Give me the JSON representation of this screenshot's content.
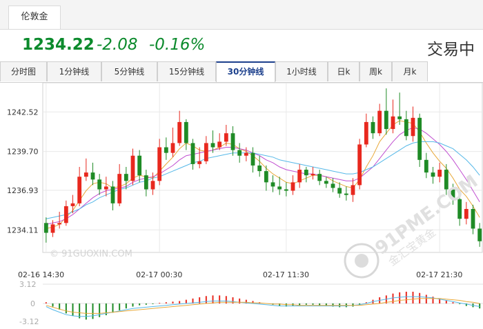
{
  "top_tab": {
    "label": "伦敦金"
  },
  "quote": {
    "price": "1234.22",
    "change": "-2.08",
    "change_pct": "-0.16%",
    "status": "交易中"
  },
  "period_tabs": [
    {
      "label": "分时图"
    },
    {
      "label": "1分钟线"
    },
    {
      "label": "5分钟线"
    },
    {
      "label": "15分钟线"
    },
    {
      "label": "30分钟线",
      "active": true
    },
    {
      "label": "1小时线"
    },
    {
      "label": "日k"
    },
    {
      "label": "周k"
    },
    {
      "label": "月k"
    }
  ],
  "watermarks": {
    "left": "© 91GUOXIN.COM",
    "right_brand": "91PME.COM",
    "right_sub": "金汇宝黄金"
  },
  "colors": {
    "up": "#e8281e",
    "down": "#1f8b26",
    "ma1": "#e8a838",
    "ma2": "#c04ed0",
    "ma3": "#55b8e8",
    "accent": "#1b3f8c"
  },
  "chart_data": {
    "type": "candlestick",
    "ylim": [
      1232.5,
      1244.6
    ],
    "y_ticks": [
      "1242.52",
      "1239.70",
      "1236.93",
      "1234.11"
    ],
    "x_tick_labels": [
      "02-16 14:30",
      "02-17 00:30",
      "02-17 11:30",
      "02-17 21:30"
    ],
    "x_tick_index": [
      0,
      17,
      36,
      59
    ],
    "macd_ticks": [
      "3.12",
      "0",
      "-3.12"
    ],
    "candles": [
      [
        1234.6,
        1233.9,
        1235.0,
        1233.2
      ],
      [
        1233.9,
        1234.5,
        1234.8,
        1233.6
      ],
      [
        1234.5,
        1234.6,
        1235.4,
        1234.2
      ],
      [
        1234.6,
        1235.8,
        1236.2,
        1234.4
      ],
      [
        1235.8,
        1236.0,
        1236.6,
        1235.3
      ],
      [
        1236.0,
        1237.9,
        1238.6,
        1235.8
      ],
      [
        1237.9,
        1238.2,
        1239.2,
        1237.6
      ],
      [
        1238.2,
        1237.7,
        1238.9,
        1237.3
      ],
      [
        1237.7,
        1237.0,
        1238.1,
        1236.6
      ],
      [
        1237.0,
        1237.2,
        1237.9,
        1236.5
      ],
      [
        1237.2,
        1236.0,
        1237.6,
        1235.5
      ],
      [
        1236.0,
        1238.1,
        1238.8,
        1235.8
      ],
      [
        1238.1,
        1237.6,
        1238.6,
        1237.0
      ],
      [
        1237.6,
        1239.4,
        1239.9,
        1237.3
      ],
      [
        1239.4,
        1238.0,
        1239.8,
        1237.5
      ],
      [
        1238.0,
        1237.0,
        1238.4,
        1236.5
      ],
      [
        1237.0,
        1237.6,
        1238.2,
        1236.6
      ],
      [
        1237.6,
        1240.0,
        1240.6,
        1237.3
      ],
      [
        1240.0,
        1239.6,
        1240.7,
        1239.1
      ],
      [
        1239.6,
        1240.3,
        1241.4,
        1239.3
      ],
      [
        1240.3,
        1241.8,
        1242.6,
        1240.1
      ],
      [
        1241.8,
        1240.3,
        1242.0,
        1239.8
      ],
      [
        1240.3,
        1238.8,
        1240.6,
        1238.4
      ],
      [
        1238.8,
        1239.0,
        1240.0,
        1238.5
      ],
      [
        1239.0,
        1240.3,
        1240.8,
        1238.8
      ],
      [
        1240.3,
        1240.0,
        1241.2,
        1239.6
      ],
      [
        1240.0,
        1240.4,
        1241.0,
        1239.8
      ],
      [
        1240.4,
        1241.0,
        1241.6,
        1240.1
      ],
      [
        1241.0,
        1239.8,
        1241.5,
        1239.4
      ],
      [
        1239.8,
        1239.4,
        1240.3,
        1238.9
      ],
      [
        1239.4,
        1239.6,
        1240.0,
        1239.0
      ],
      [
        1239.6,
        1238.7,
        1240.0,
        1238.2
      ],
      [
        1238.7,
        1238.3,
        1239.4,
        1237.9
      ],
      [
        1238.3,
        1237.5,
        1238.7,
        1236.9
      ],
      [
        1237.5,
        1237.2,
        1238.0,
        1236.8
      ],
      [
        1237.2,
        1237.0,
        1237.9,
        1236.6
      ],
      [
        1237.0,
        1236.9,
        1237.5,
        1236.5
      ],
      [
        1236.9,
        1237.5,
        1238.0,
        1236.6
      ],
      [
        1237.5,
        1238.4,
        1238.8,
        1237.1
      ],
      [
        1238.4,
        1238.0,
        1238.6,
        1237.5
      ],
      [
        1238.0,
        1238.1,
        1238.6,
        1237.7
      ],
      [
        1238.1,
        1237.6,
        1238.4,
        1237.3
      ],
      [
        1237.6,
        1237.4,
        1237.9,
        1237.1
      ],
      [
        1237.4,
        1237.1,
        1237.8,
        1236.8
      ],
      [
        1237.1,
        1236.7,
        1237.5,
        1236.4
      ],
      [
        1236.7,
        1236.6,
        1237.2,
        1236.2
      ],
      [
        1236.6,
        1237.3,
        1237.8,
        1236.1
      ],
      [
        1237.3,
        1240.2,
        1240.6,
        1237.0
      ],
      [
        1240.2,
        1241.8,
        1242.4,
        1240.0
      ],
      [
        1241.8,
        1241.0,
        1242.2,
        1240.6
      ],
      [
        1241.0,
        1242.6,
        1243.1,
        1240.8
      ],
      [
        1242.6,
        1241.3,
        1244.2,
        1240.9
      ],
      [
        1241.3,
        1242.2,
        1243.4,
        1241.0
      ],
      [
        1242.2,
        1242.0,
        1243.9,
        1241.6
      ],
      [
        1242.0,
        1240.8,
        1242.6,
        1240.5
      ],
      [
        1240.8,
        1242.1,
        1242.9,
        1240.4
      ],
      [
        1242.1,
        1239.1,
        1242.4,
        1238.6
      ],
      [
        1239.1,
        1238.2,
        1239.6,
        1237.8
      ],
      [
        1238.2,
        1237.9,
        1238.6,
        1237.4
      ],
      [
        1237.9,
        1238.4,
        1238.9,
        1237.5
      ],
      [
        1238.4,
        1237.0,
        1238.8,
        1236.6
      ],
      [
        1237.0,
        1236.3,
        1237.4,
        1235.9
      ],
      [
        1236.3,
        1234.9,
        1236.7,
        1234.4
      ],
      [
        1234.9,
        1235.6,
        1236.1,
        1234.5
      ],
      [
        1235.6,
        1234.2,
        1235.9,
        1233.8
      ],
      [
        1234.2,
        1233.3,
        1234.6,
        1232.9
      ]
    ],
    "ma_fast": [
      1234.2,
      1234.3,
      1234.5,
      1235.0,
      1235.5,
      1236.2,
      1236.9,
      1237.4,
      1237.5,
      1237.4,
      1237.1,
      1237.2,
      1237.4,
      1237.8,
      1238.0,
      1237.9,
      1237.8,
      1238.3,
      1238.8,
      1239.3,
      1239.9,
      1240.3,
      1240.1,
      1239.8,
      1239.7,
      1239.8,
      1240.0,
      1240.3,
      1240.2,
      1239.9,
      1239.7,
      1239.4,
      1239.0,
      1238.5,
      1238.1,
      1237.8,
      1237.5,
      1237.4,
      1237.6,
      1237.8,
      1238.0,
      1238.0,
      1237.9,
      1237.6,
      1237.4,
      1237.2,
      1237.1,
      1237.7,
      1238.6,
      1239.4,
      1240.4,
      1241.0,
      1241.6,
      1241.9,
      1241.8,
      1241.7,
      1241.1,
      1240.3,
      1239.6,
      1239.0,
      1238.5,
      1237.8,
      1237.0,
      1236.5,
      1235.8,
      1235.0
    ],
    "ma_mid": [
      1234.5,
      1234.6,
      1234.7,
      1234.9,
      1235.2,
      1235.6,
      1236.0,
      1236.4,
      1236.7,
      1236.9,
      1237.0,
      1237.1,
      1237.2,
      1237.5,
      1237.7,
      1237.8,
      1237.9,
      1238.1,
      1238.4,
      1238.7,
      1239.1,
      1239.4,
      1239.5,
      1239.6,
      1239.7,
      1239.8,
      1239.9,
      1240.0,
      1240.0,
      1239.9,
      1239.8,
      1239.6,
      1239.4,
      1239.1,
      1238.9,
      1238.6,
      1238.4,
      1238.3,
      1238.2,
      1238.1,
      1238.1,
      1238.0,
      1237.9,
      1237.8,
      1237.7,
      1237.6,
      1237.6,
      1237.8,
      1238.2,
      1238.6,
      1239.2,
      1239.8,
      1240.4,
      1240.9,
      1241.2,
      1241.4,
      1241.3,
      1241.0,
      1240.6,
      1240.2,
      1239.7,
      1239.1,
      1238.4,
      1237.7,
      1236.9,
      1236.1
    ],
    "ma_slow": [
      1234.9,
      1235.0,
      1235.1,
      1235.2,
      1235.4,
      1235.6,
      1235.9,
      1236.1,
      1236.4,
      1236.6,
      1236.8,
      1237.0,
      1237.1,
      1237.3,
      1237.5,
      1237.6,
      1237.8,
      1237.9,
      1238.1,
      1238.3,
      1238.5,
      1238.7,
      1238.9,
      1239.0,
      1239.2,
      1239.3,
      1239.4,
      1239.5,
      1239.6,
      1239.6,
      1239.6,
      1239.6,
      1239.5,
      1239.4,
      1239.3,
      1239.1,
      1239.0,
      1238.9,
      1238.8,
      1238.7,
      1238.6,
      1238.5,
      1238.4,
      1238.3,
      1238.2,
      1238.1,
      1238.1,
      1238.2,
      1238.4,
      1238.6,
      1238.9,
      1239.2,
      1239.5,
      1239.8,
      1240.1,
      1240.3,
      1240.4,
      1240.4,
      1240.4,
      1240.3,
      1240.1,
      1239.9,
      1239.5,
      1239.1,
      1238.6,
      1238.0
    ],
    "macd_hist": [
      0.2,
      -0.5,
      -1.0,
      -1.6,
      -2.0,
      -2.4,
      -2.6,
      -2.5,
      -2.2,
      -1.9,
      -1.5,
      -1.1,
      -0.8,
      -0.5,
      -0.3,
      -0.2,
      -0.1,
      0.1,
      0.2,
      0.3,
      0.4,
      0.6,
      0.8,
      1.0,
      1.2,
      1.3,
      1.3,
      1.2,
      1.0,
      0.8,
      0.6,
      0.4,
      0.2,
      0.0,
      -0.2,
      -0.4,
      -0.5,
      -0.4,
      -0.3,
      -0.2,
      -0.2,
      -0.3,
      -0.4,
      -0.5,
      -0.6,
      -0.6,
      -0.5,
      -0.2,
      0.2,
      0.6,
      1.0,
      1.3,
      1.6,
      1.8,
      1.9,
      1.9,
      1.7,
      1.4,
      1.1,
      0.8,
      0.5,
      0.2,
      -0.1,
      -0.4,
      -0.6,
      -0.8
    ],
    "macd_dif": [
      -0.5,
      -1.0,
      -1.4,
      -1.8,
      -2.0,
      -2.1,
      -2.1,
      -2.0,
      -1.8,
      -1.6,
      -1.4,
      -1.2,
      -1.0,
      -0.8,
      -0.7,
      -0.6,
      -0.5,
      -0.4,
      -0.3,
      -0.2,
      -0.1,
      0.0,
      0.1,
      0.2,
      0.3,
      0.4,
      0.4,
      0.4,
      0.3,
      0.2,
      0.1,
      0.0,
      -0.1,
      -0.2,
      -0.3,
      -0.4,
      -0.4,
      -0.4,
      -0.4,
      -0.4,
      -0.4,
      -0.4,
      -0.4,
      -0.4,
      -0.4,
      -0.4,
      -0.3,
      -0.2,
      0.0,
      0.3,
      0.5,
      0.7,
      0.9,
      1.0,
      1.1,
      1.1,
      1.1,
      1.0,
      0.9,
      0.7,
      0.5,
      0.3,
      0.1,
      -0.1,
      -0.3,
      -0.5
    ],
    "macd_dea": [
      -0.3,
      -0.6,
      -0.9,
      -1.2,
      -1.4,
      -1.5,
      -1.6,
      -1.6,
      -1.6,
      -1.5,
      -1.4,
      -1.3,
      -1.2,
      -1.1,
      -1.0,
      -0.9,
      -0.8,
      -0.7,
      -0.6,
      -0.5,
      -0.4,
      -0.3,
      -0.2,
      -0.1,
      0.0,
      0.1,
      0.2,
      0.2,
      0.2,
      0.2,
      0.2,
      0.1,
      0.1,
      0.0,
      -0.1,
      -0.1,
      -0.2,
      -0.2,
      -0.3,
      -0.3,
      -0.3,
      -0.3,
      -0.3,
      -0.3,
      -0.3,
      -0.3,
      -0.3,
      -0.3,
      -0.2,
      -0.1,
      0.0,
      0.2,
      0.3,
      0.5,
      0.6,
      0.7,
      0.8,
      0.8,
      0.8,
      0.8,
      0.7,
      0.6,
      0.5,
      0.3,
      0.2,
      0.0
    ]
  }
}
